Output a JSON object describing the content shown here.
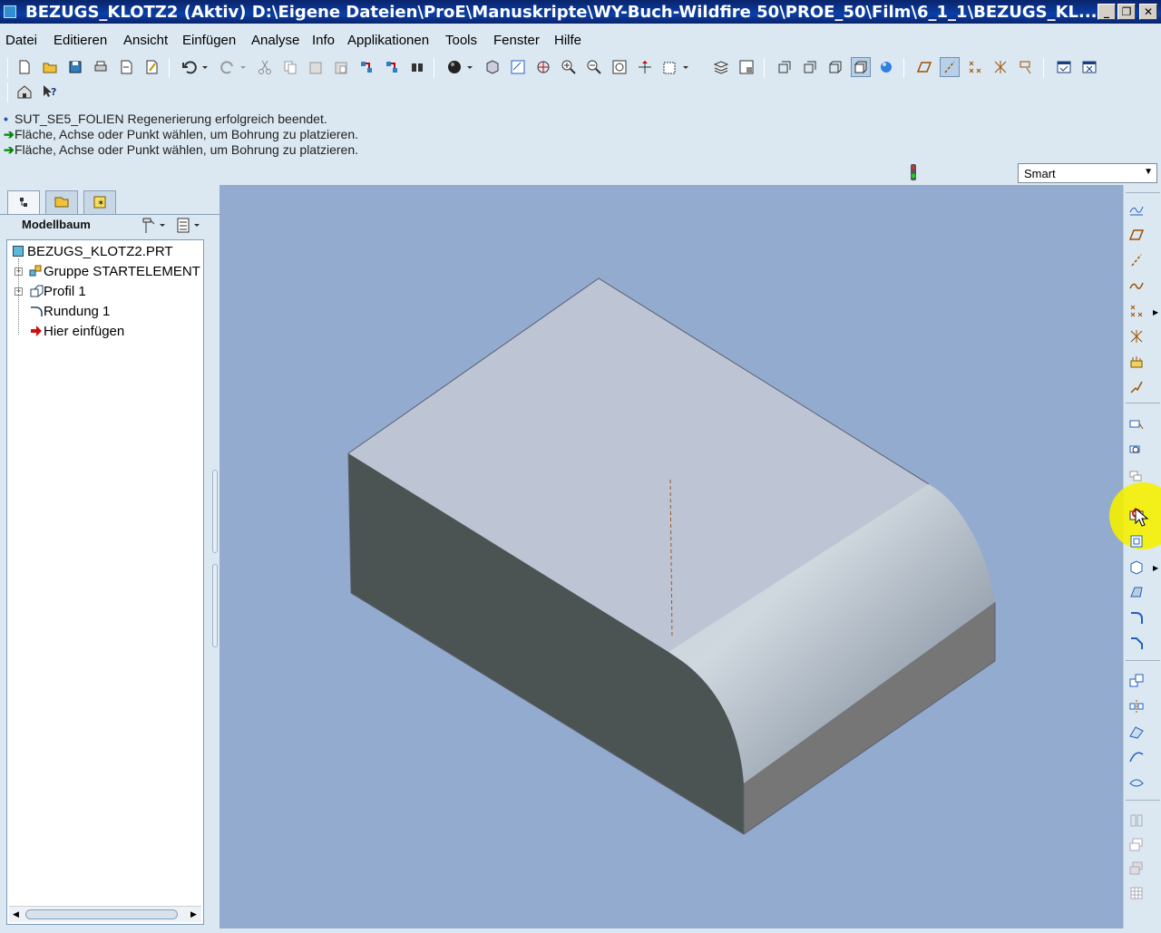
{
  "window": {
    "title": "BEZUGS_KLOTZ2 (Aktiv) D:\\Eigene Dateien\\ProE\\Manuskripte\\WY-Buch-Wildfire 50\\PROE_50\\Film\\6_1_1\\BEZUGS_KL...",
    "minimize": "_",
    "maximize": "❐",
    "close": "✕"
  },
  "menu": [
    "Datei",
    "Editieren",
    "Ansicht",
    "Einfügen",
    "Analyse",
    "Info",
    "Applikationen",
    "Tools",
    "Fenster",
    "Hilfe"
  ],
  "messages": [
    {
      "kind": "info",
      "text": "SUT_SE5_FOLIEN Regenerierung erfolgreich beendet."
    },
    {
      "kind": "prompt",
      "text": "Fläche, Achse oder Punkt wählen, um Bohrung zu platzieren."
    },
    {
      "kind": "prompt",
      "text": "Fläche, Achse oder Punkt wählen, um Bohrung zu platzieren."
    }
  ],
  "selection_filter": {
    "value": "Smart"
  },
  "left_panel": {
    "title": "Modellbaum",
    "tree": [
      {
        "label": "BEZUGS_KLOTZ2.PRT",
        "icon": "part-icon"
      },
      {
        "label": "Gruppe STARTELEMENT",
        "icon": "group-icon"
      },
      {
        "label": "Profil 1",
        "icon": "extrude-icon"
      },
      {
        "label": "Rundung 1",
        "icon": "round-icon"
      },
      {
        "label": "Hier einfügen",
        "icon": "insert-arrow-icon"
      }
    ]
  },
  "colors": {
    "viewport_bg": "#93abce",
    "titlebar": "#0a246a",
    "panel_bg": "#dbe8f1",
    "highlight": "#f5f000"
  }
}
